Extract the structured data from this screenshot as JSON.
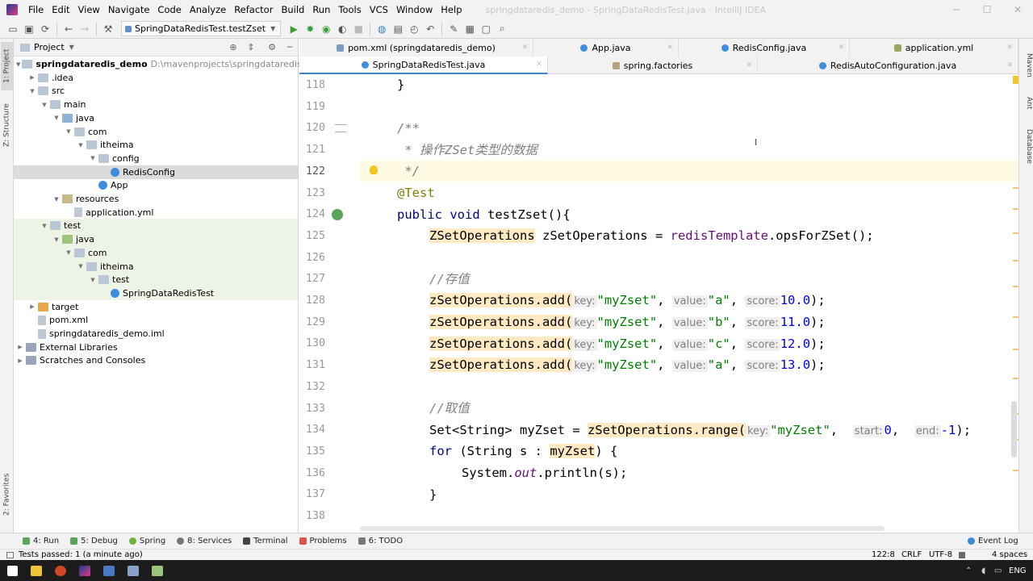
{
  "menubar": {
    "items": [
      "File",
      "Edit",
      "View",
      "Navigate",
      "Code",
      "Analyze",
      "Refactor",
      "Build",
      "Run",
      "Tools",
      "VCS",
      "Window",
      "Help"
    ],
    "window_title": "springdataredis_demo - SpringDataRedisTest.java - IntelliJ IDEA"
  },
  "toolbar": {
    "run_config": "SpringDataRedisTest.testZset"
  },
  "left_strip": {
    "project": "1: Project",
    "structure": "Z: Structure",
    "favorites": "2: Favorites"
  },
  "right_strip": {
    "maven": "Maven",
    "ant": "Ant",
    "database": "Database"
  },
  "project_panel": {
    "title": "Project",
    "tree": [
      {
        "label": "springdataredis_demo",
        "path": "D:\\mavenprojects\\springdataredis_demo",
        "depth": 0,
        "icon": "folder",
        "arrow": "▼"
      },
      {
        "label": ".idea",
        "depth": 1,
        "icon": "folder",
        "arrow": "▶"
      },
      {
        "label": "src",
        "depth": 1,
        "icon": "folder",
        "arrow": "▼"
      },
      {
        "label": "main",
        "depth": 2,
        "icon": "folder",
        "arrow": "▼"
      },
      {
        "label": "java",
        "depth": 3,
        "icon": "src",
        "arrow": "▼"
      },
      {
        "label": "com",
        "depth": 4,
        "icon": "folder",
        "arrow": "▼"
      },
      {
        "label": "itheima",
        "depth": 5,
        "icon": "folder",
        "arrow": "▼"
      },
      {
        "label": "config",
        "depth": 6,
        "icon": "folder",
        "arrow": "▼"
      },
      {
        "label": "RedisConfig",
        "depth": 7,
        "icon": "class",
        "arrow": ""
      },
      {
        "label": "App",
        "depth": 6,
        "icon": "class",
        "arrow": ""
      },
      {
        "label": "resources",
        "depth": 3,
        "icon": "res",
        "arrow": "▼"
      },
      {
        "label": "application.yml",
        "depth": 4,
        "icon": "file",
        "arrow": ""
      },
      {
        "label": "test",
        "depth": 2,
        "icon": "folder",
        "arrow": "▼"
      },
      {
        "label": "java",
        "depth": 3,
        "icon": "test",
        "arrow": "▼"
      },
      {
        "label": "com",
        "depth": 4,
        "icon": "folder",
        "arrow": "▼"
      },
      {
        "label": "itheima",
        "depth": 5,
        "icon": "folder",
        "arrow": "▼"
      },
      {
        "label": "test",
        "depth": 6,
        "icon": "folder",
        "arrow": "▼"
      },
      {
        "label": "SpringDataRedisTest",
        "depth": 7,
        "icon": "class",
        "arrow": ""
      },
      {
        "label": "target",
        "depth": 1,
        "icon": "orange",
        "arrow": "▶"
      },
      {
        "label": "pom.xml",
        "depth": 1,
        "icon": "file",
        "arrow": ""
      },
      {
        "label": "springdataredis_demo.iml",
        "depth": 1,
        "icon": "file",
        "arrow": ""
      },
      {
        "label": "External Libraries",
        "depth": 0,
        "icon": "lib",
        "arrow": "▶"
      },
      {
        "label": "Scratches and Consoles",
        "depth": 0,
        "icon": "lib",
        "arrow": "▶"
      }
    ]
  },
  "editor_tabs": {
    "row1": [
      "pom.xml (springdataredis_demo)",
      "App.java",
      "RedisConfig.java",
      "application.yml"
    ],
    "row2": [
      "SpringDataRedisTest.java",
      "spring.factories",
      "RedisAutoConfiguration.java"
    ],
    "active": "SpringDataRedisTest.java"
  },
  "editor": {
    "line_numbers": [
      "118",
      "119",
      "120",
      "121",
      "122",
      "123",
      "124",
      "125",
      "126",
      "127",
      "128",
      "129",
      "130",
      "131",
      "132",
      "133",
      "134",
      "135",
      "136",
      "137",
      "138"
    ],
    "current_line": "122",
    "code": {
      "l118": "}",
      "l120": "/**",
      "l121": " * 操作ZSet类型的数据",
      "l122": " */",
      "l123": "@Test",
      "l124_kw1": "public",
      "l124_kw2": "void",
      "l124_rest": "testZset(){",
      "l125_type": "ZSetOperations",
      "l125_mid": " zSetOperations = ",
      "l125_field": "redisTemplate",
      "l125_end": ".opsForZSet();",
      "l127": "//存值",
      "add_call": "zSetOperations.add(",
      "hint_key": "key:",
      "hint_value": "value:",
      "hint_score": "score:",
      "arg_key": "\"myZset\"",
      "add_rows": [
        {
          "value": "\"a\"",
          "score": "10.0"
        },
        {
          "value": "\"b\"",
          "score": "11.0"
        },
        {
          "value": "\"c\"",
          "score": "12.0"
        },
        {
          "value": "\"a\"",
          "score": "13.0"
        }
      ],
      "l133": "//取值",
      "l134_a": "Set<String> myZset = ",
      "l134_call": "zSetOperations.range(",
      "l134_key": "\"myZset\"",
      "hint_start": "start:",
      "l134_start": "0",
      "hint_end": "end:",
      "l134_end": "-1",
      "l134_tail": ");",
      "l135_kw": "for",
      "l135_mid": " (String s : ",
      "l135_var": "myZset",
      "l135_end": ") {",
      "l136_a": "System.",
      "l136_out": "out",
      "l136_b": ".println(s);",
      "l137": "}"
    }
  },
  "bottom_tabs": {
    "items": [
      "4: Run",
      "5: Debug",
      "Spring",
      "8: Services",
      "Terminal",
      "Problems",
      "6: TODO"
    ],
    "event_log": "Event Log"
  },
  "statusbar": {
    "message": "Tests passed: 1 (a minute ago)",
    "position": "122:8",
    "line_sep": "CRLF",
    "encoding": "UTF-8",
    "indent": "4 spaces"
  },
  "taskbar": {
    "lang": "ENG"
  }
}
